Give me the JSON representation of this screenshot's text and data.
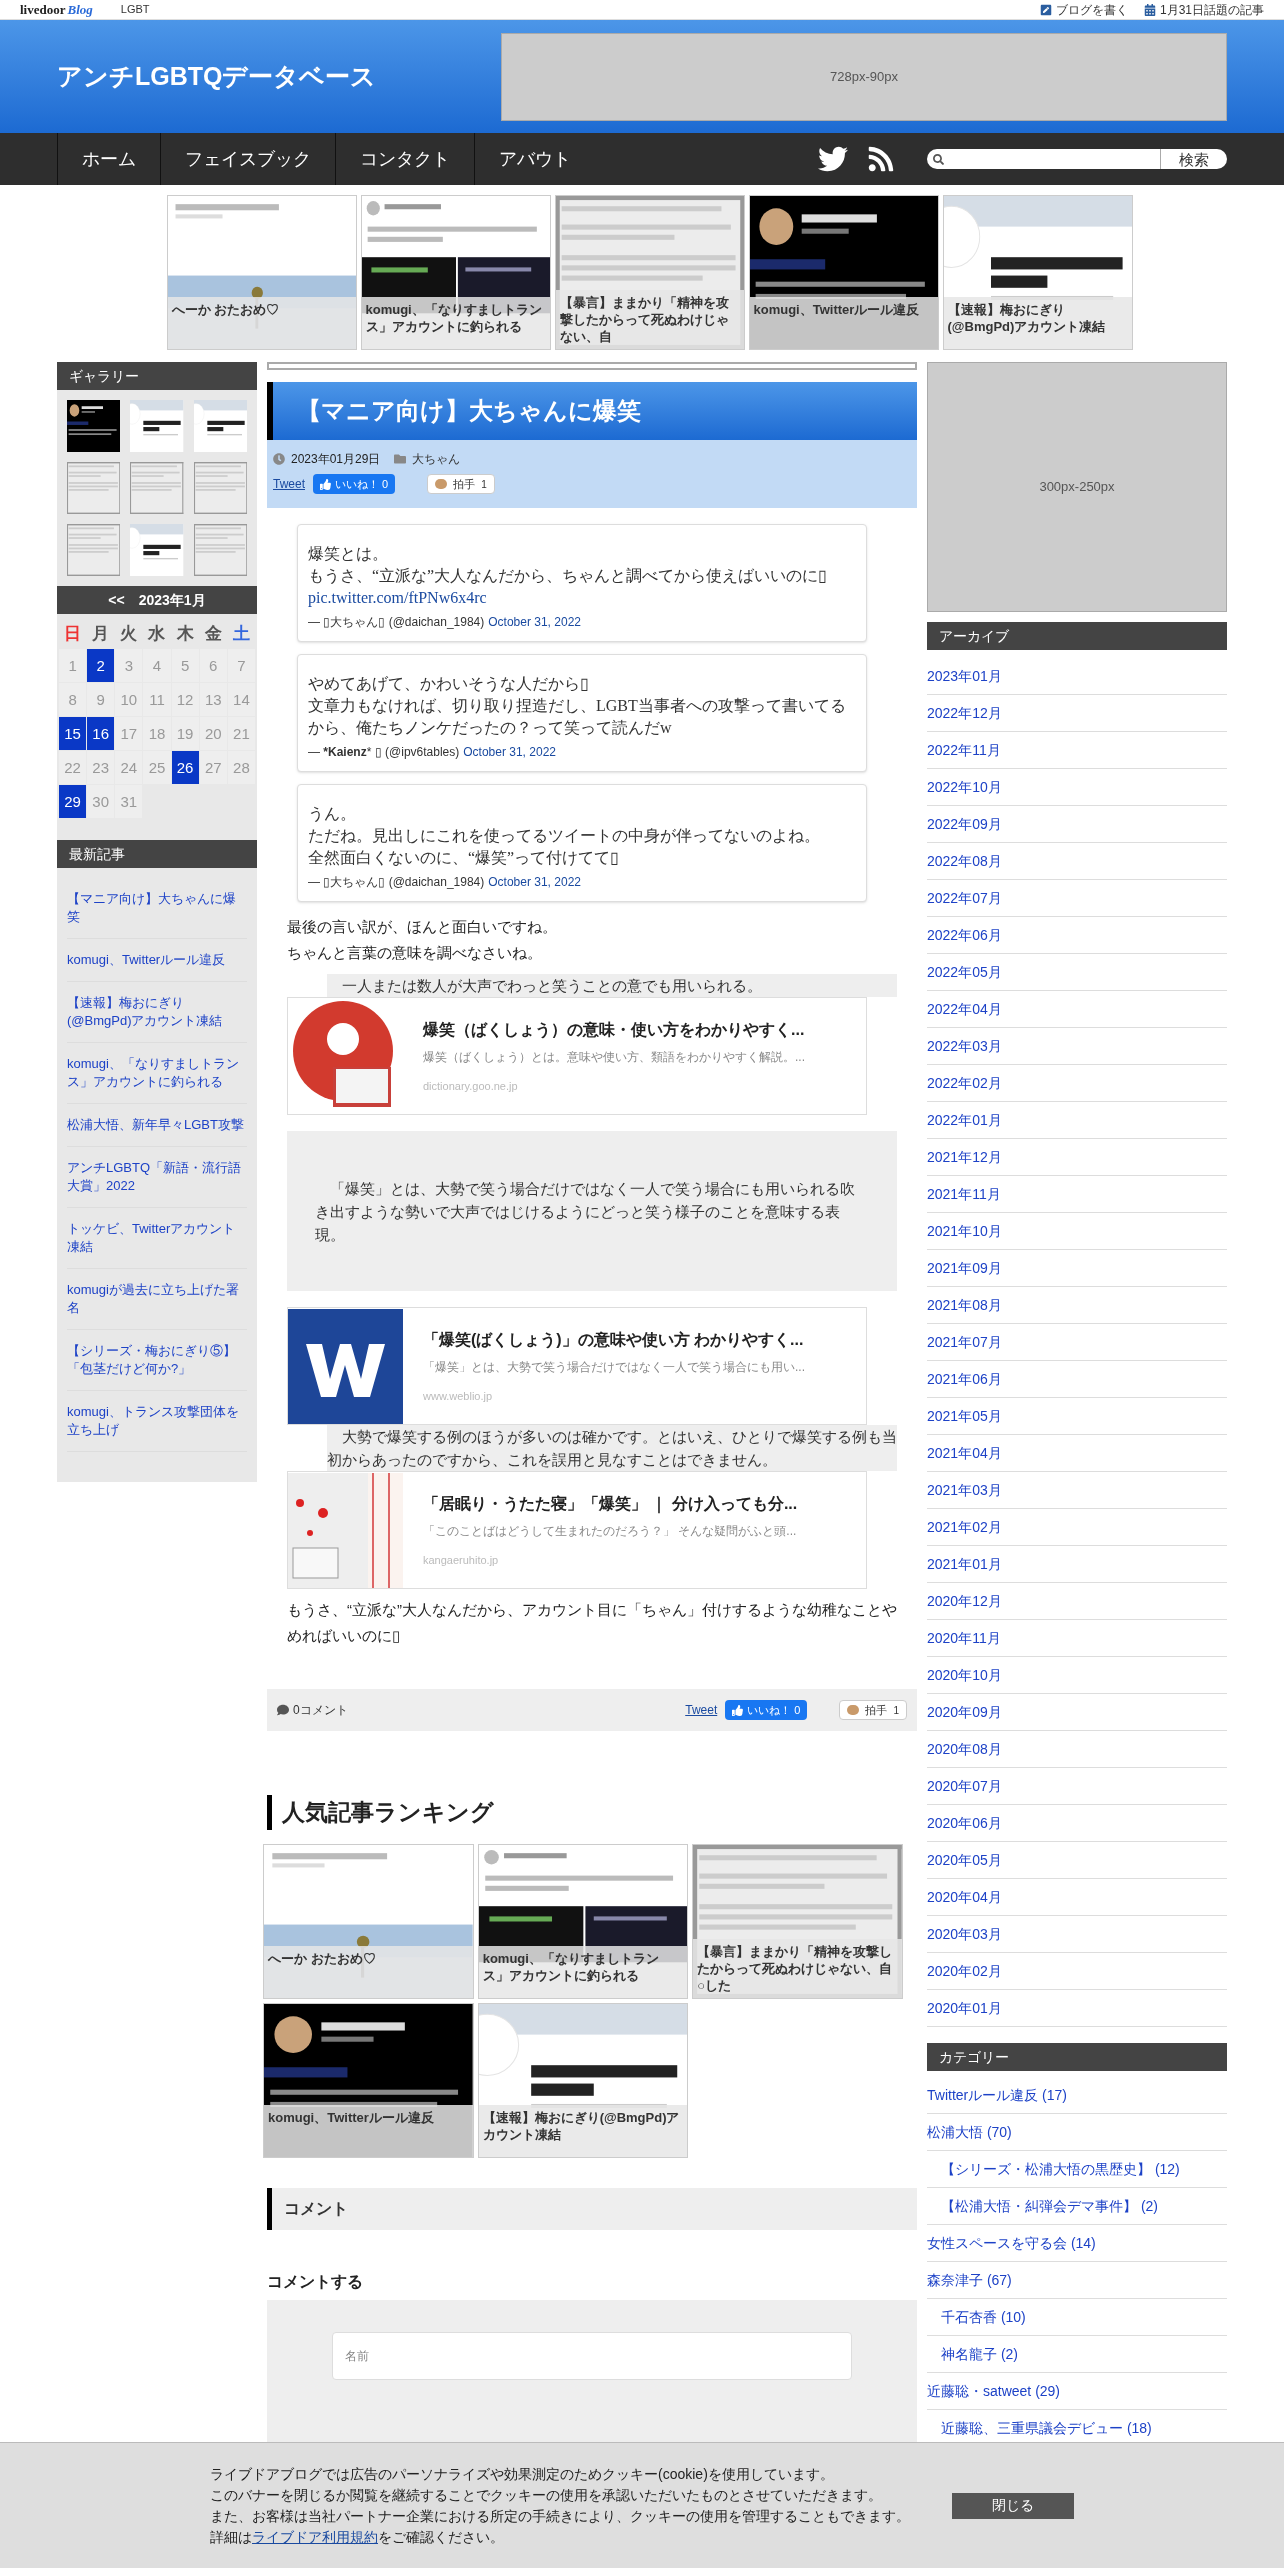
{
  "topbar": {
    "logo_main": "livedoor",
    "logo_sub": "Blog",
    "category": "LGBT",
    "links": [
      {
        "kind": "write",
        "label": "ブログを書く"
      },
      {
        "kind": "calendar",
        "label": "1月31日話題の記事"
      }
    ]
  },
  "header": {
    "title": "アンチLGBTQデータベース",
    "ad": "728px-90px"
  },
  "nav": {
    "items": [
      "ホーム",
      "フェイスブック",
      "コンタクト",
      "アバウト"
    ],
    "search_button": "検索"
  },
  "featured": [
    {
      "caption": "へーか おたおめ♡"
    },
    {
      "caption": "komugi、「なりすましトランス」アカウントに釣られる"
    },
    {
      "caption": "【暴言】ままかり「精神を攻撃したからって死ぬわけじゃない、自"
    },
    {
      "caption": "komugi、Twitterルール違反"
    },
    {
      "caption": "【速報】梅おにぎり(@BmgPd)アカウント凍結"
    }
  ],
  "gallery": {
    "title": "ギャラリー"
  },
  "calendar": {
    "prev": "<<",
    "title": "2023年1月",
    "weekdays": [
      {
        "label": "日",
        "color": "#ee3333"
      },
      {
        "label": "月",
        "color": "#555555"
      },
      {
        "label": "火",
        "color": "#555555"
      },
      {
        "label": "水",
        "color": "#555555"
      },
      {
        "label": "木",
        "color": "#555555"
      },
      {
        "label": "金",
        "color": "#555555"
      },
      {
        "label": "土",
        "color": "#3366dd"
      }
    ],
    "days": [
      {
        "day": "1",
        "linked": false
      },
      {
        "day": "2",
        "linked": true
      },
      {
        "day": "3",
        "linked": false
      },
      {
        "day": "4",
        "linked": false
      },
      {
        "day": "5",
        "linked": false
      },
      {
        "day": "6",
        "linked": false
      },
      {
        "day": "7",
        "linked": false
      },
      {
        "day": "8",
        "linked": false
      },
      {
        "day": "9",
        "linked": false
      },
      {
        "day": "10",
        "linked": false
      },
      {
        "day": "11",
        "linked": false
      },
      {
        "day": "12",
        "linked": false
      },
      {
        "day": "13",
        "linked": false
      },
      {
        "day": "14",
        "linked": false
      },
      {
        "day": "15",
        "linked": true
      },
      {
        "day": "16",
        "linked": true
      },
      {
        "day": "17",
        "linked": false
      },
      {
        "day": "18",
        "linked": false
      },
      {
        "day": "19",
        "linked": false
      },
      {
        "day": "20",
        "linked": false
      },
      {
        "day": "21",
        "linked": false
      },
      {
        "day": "22",
        "linked": false
      },
      {
        "day": "23",
        "linked": false
      },
      {
        "day": "24",
        "linked": false
      },
      {
        "day": "25",
        "linked": false
      },
      {
        "day": "26",
        "linked": true
      },
      {
        "day": "27",
        "linked": false
      },
      {
        "day": "28",
        "linked": false
      },
      {
        "day": "29",
        "linked": true
      },
      {
        "day": "30",
        "linked": false
      },
      {
        "day": "31",
        "linked": false
      }
    ]
  },
  "recent": {
    "title": "最新記事",
    "items": [
      "【マニア向け】大ちゃんに爆笑",
      "komugi、Twitterルール違反",
      "【速報】梅おにぎり(@BmgPd)アカウント凍結",
      "komugi、「なりすましトランス」アカウントに釣られる",
      "松浦大悟、新年早々LGBT攻撃",
      "アンチLGBTQ「新語・流行語大賞」2022",
      "トッケビ、Twitterアカウント凍結",
      "komugiが過去に立ち上げた署名",
      "【シリーズ・梅おにぎり⑤】「包茎だけど何か?」",
      "komugi、トランス攻撃団体を立ち上げ"
    ]
  },
  "article": {
    "title": "【マニア向け】大ちゃんに爆笑",
    "date": "2023年01月29日",
    "category": "大ちゃん",
    "share_top": {
      "tweet": "Tweet",
      "like": "いいね！ 0",
      "clap": "拍手",
      "clap_count": "1"
    },
    "blocks": [
      {
        "kind": "tweet",
        "lines": [
          "爆笑とは。",
          "もうさ、“立派な”大人なんだから、ちゃんと調べてから使えばいいのに▯"
        ],
        "link": "pic.twitter.com/ftPNw6x4rc",
        "author": "— ▯大ちゃん▯ (@daichan_1984)",
        "date": "October 31, 2022"
      },
      {
        "kind": "tweet",
        "lines": [
          "やめてあげて、かわいそうな人だから▯",
          "文章力もなければ、切り取り捏造だし、LGBT当事者への攻撃って書いてるから、俺たちノンケだったの？って笑って読んだw"
        ],
        "author": "— ***Kaienz*** ▯ (@ipv6tables)",
        "date": "October 31, 2022"
      },
      {
        "kind": "tweet",
        "lines": [
          "うん。",
          "ただね。見出しにこれを使ってるツイートの中身が伴ってないのよね。",
          "全然面白くないのに、“爆笑”って付けてて▯"
        ],
        "author": "— ▯大ちゃん▯ (@daichan_1984)",
        "date": "October 31, 2022"
      },
      {
        "kind": "text",
        "lines": [
          "最後の言い訳が、ほんと面白いですね。",
          "ちゃんと言葉の意味を調べなさいね。"
        ]
      },
      {
        "kind": "band",
        "text": "　一人または数人が大声でわっと笑うことの意でも用いられる。"
      },
      {
        "kind": "card",
        "logo": {
          "kind": "goo"
        },
        "title": "爆笑（ばくしょう）の意味・使い方をわかりやすく...",
        "desc": "爆笑（ばくしょう）とは。意味や使い方、類語をわかりやすく解説。...",
        "site": "dictionary.goo.ne.jp"
      },
      {
        "kind": "quote",
        "text": "　「爆笑」とは、大勢で笑う場合だけではなく一人で笑う場合にも用いられる吹き出すような勢いで大声ではじけるようにどっと笑う様子のことを意味する表現。"
      },
      {
        "kind": "card",
        "logo": {
          "kind": "weblio"
        },
        "title": "「爆笑(ばくしょう)」の意味や使い方 わかりやすく...",
        "desc": "「爆笑」とは、大勢で笑う場合だけではなく一人で笑う場合にも用い...",
        "site": "www.weblio.jp"
      },
      {
        "kind": "band",
        "text": "　大勢で爆笑する例のほうが多いのは確かです。とはいえ、ひとりで爆笑する例も当初からあったのですから、これを誤用と見なすことはできません。"
      },
      {
        "kind": "card",
        "logo": {
          "kind": "book"
        },
        "title": "「居眠り・うたた寝」「爆笑」 ｜ 分け入っても分...",
        "desc": "「このことばはどうして生まれたのだろう？」 そんな疑問がふと頭...",
        "site": "kangaeruhito.jp"
      },
      {
        "kind": "text",
        "lines": [
          "もうさ、“立派な”大人なんだから、アカウント目に「ちゃん」付けするような幼稚なことやめればいいのに▯"
        ]
      }
    ],
    "comments": "0コメント",
    "share_bottom": {
      "tweet": "Tweet",
      "like": "いいね！ 0",
      "clap": "拍手",
      "clap_count": "1"
    }
  },
  "ranking": {
    "title": "人気記事ランキング",
    "items": [
      {
        "caption": "へーか おたおめ♡"
      },
      {
        "caption": "komugi、「なりすましトランス」アカウントに釣られる"
      },
      {
        "caption": "【暴言】ままかり「精神を攻撃したからって死ぬわけじゃない、自○した"
      },
      {
        "caption": "komugi、Twitterルール違反"
      },
      {
        "caption": "【速報】梅おにぎり(@BmgPd)アカウント凍結"
      }
    ]
  },
  "comment_section": {
    "title": "コメント",
    "form_title": "コメントする",
    "name_placeholder": "名前"
  },
  "right": {
    "ad": "300px-250px",
    "archive_title": "アーカイブ",
    "archive": [
      "2023年01月",
      "2022年12月",
      "2022年11月",
      "2022年10月",
      "2022年09月",
      "2022年08月",
      "2022年07月",
      "2022年06月",
      "2022年05月",
      "2022年04月",
      "2022年03月",
      "2022年02月",
      "2022年01月",
      "2021年12月",
      "2021年11月",
      "2021年10月",
      "2021年09月",
      "2021年08月",
      "2021年07月",
      "2021年06月",
      "2021年05月",
      "2021年04月",
      "2021年03月",
      "2021年02月",
      "2021年01月",
      "2020年12月",
      "2020年11月",
      "2020年10月",
      "2020年09月",
      "2020年08月",
      "2020年07月",
      "2020年06月",
      "2020年05月",
      "2020年04月",
      "2020年03月",
      "2020年02月",
      "2020年01月"
    ],
    "category_title": "カテゴリー",
    "categories": [
      {
        "label": "Twitterルール違反 (17)"
      },
      {
        "label": "松浦大悟 (70)",
        "children": [
          {
            "label": "【シリーズ・松浦大悟の黒歴史】 (12)"
          },
          {
            "label": "【松浦大悟・糾弾会デマ事件】 (2)"
          }
        ]
      },
      {
        "label": "女性スペースを守る会 (14)"
      },
      {
        "label": "森奈津子 (67)",
        "children": [
          {
            "label": "千石杏香 (10)"
          },
          {
            "label": "神名龍子 (2)"
          }
        ]
      },
      {
        "label": "近藤聡・satweet (29)",
        "children": [
          {
            "label": "近藤聡、三重県議会デビュー (18)"
          }
        ]
      }
    ]
  },
  "cookie": {
    "lines": [
      "ライブドアブログでは広告のパーソナライズや効果測定のためクッキー(cookie)を使用しています。",
      "このバナーを閉じるか閲覧を継続することでクッキーの使用を承認いただいたものとさせていただきます。",
      "また、お客様は当社パートナー企業における所定の手続きにより、クッキーの使用を管理することもできます。"
    ],
    "detail_before": "詳細は",
    "detail_link": "ライブドア利用規約",
    "detail_after": "をご確認ください。",
    "close": "閉じる"
  }
}
